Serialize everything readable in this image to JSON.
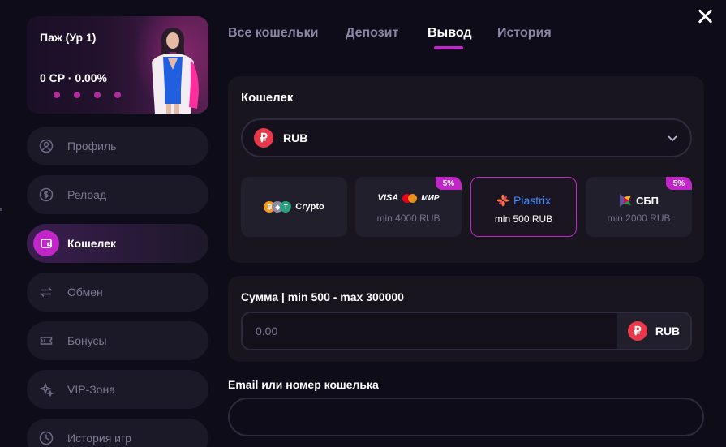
{
  "profile": {
    "name": "Паж (Ур 1)",
    "cp": "0 CP · 0.00%"
  },
  "sidebar": {
    "items": [
      {
        "label": "Профиль",
        "icon": "user-icon"
      },
      {
        "label": "Релоад",
        "icon": "dollar-icon"
      },
      {
        "label": "Кошелек",
        "icon": "wallet-icon",
        "active": true
      },
      {
        "label": "Обмен",
        "icon": "exchange-icon"
      },
      {
        "label": "Бонусы",
        "icon": "ticket-icon"
      },
      {
        "label": "VIP-Зона",
        "icon": "sparkle-icon"
      },
      {
        "label": "История игр",
        "icon": "clock-icon"
      }
    ]
  },
  "tabs": [
    {
      "label": "Все кошельки"
    },
    {
      "label": "Депозит"
    },
    {
      "label": "Вывод",
      "active": true
    },
    {
      "label": "История"
    }
  ],
  "wallet": {
    "title": "Кошелек",
    "currency_symbol": "₽",
    "currency": "RUB",
    "methods": [
      {
        "brand": "Crypto",
        "min": "",
        "badge": ""
      },
      {
        "brand": "VISA · МИР",
        "visa": "VISA",
        "mir": "МИР",
        "min": "min 4000 RUB",
        "badge": "5%"
      },
      {
        "brand": "Piastrix",
        "min": "min 500 RUB",
        "badge": "",
        "selected": true
      },
      {
        "brand": "СБП",
        "min": "min 2000 RUB",
        "badge": "5%"
      }
    ]
  },
  "amount": {
    "label": "Сумма | min 500 - max 300000",
    "placeholder": "0.00",
    "currency_symbol": "₽",
    "currency": "RUB"
  },
  "email": {
    "label": "Email или номер кошелька",
    "placeholder": ""
  },
  "colors": {
    "accent": "#c126c8",
    "background": "#0e0c18",
    "panel": "#18151f",
    "rub": "#e8394b"
  }
}
